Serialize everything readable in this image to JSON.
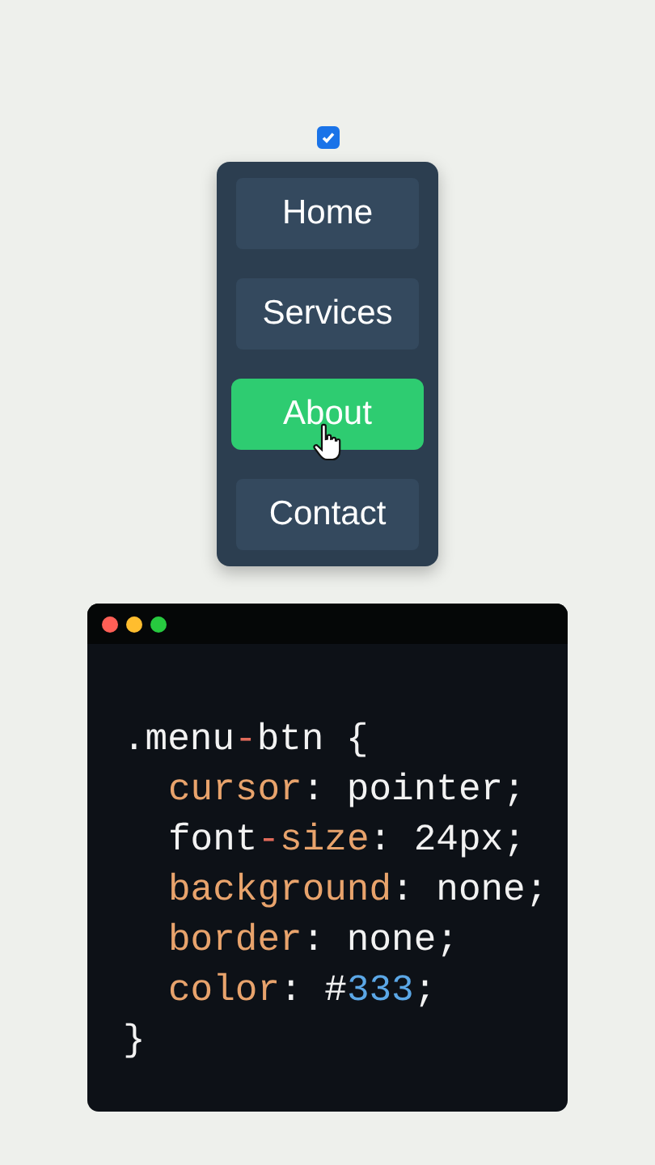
{
  "checkbox": {
    "checked": true
  },
  "menu": [
    {
      "label": "Home",
      "hovered": false
    },
    {
      "label": "Services",
      "hovered": false
    },
    {
      "label": "About",
      "hovered": true
    },
    {
      "label": "Contact",
      "hovered": false
    }
  ],
  "code": {
    "lines": [
      {
        "indent": false,
        "tokens": [
          {
            "kind": "plain",
            "text": ".menu"
          },
          {
            "kind": "operator",
            "text": "-"
          },
          {
            "kind": "plain",
            "text": "btn {"
          }
        ]
      },
      {
        "indent": true,
        "tokens": [
          {
            "kind": "property",
            "text": "cursor"
          },
          {
            "kind": "plain",
            "text": ": pointer;"
          }
        ]
      },
      {
        "indent": true,
        "tokens": [
          {
            "kind": "plain",
            "text": "font"
          },
          {
            "kind": "operator",
            "text": "-"
          },
          {
            "kind": "property",
            "text": "size"
          },
          {
            "kind": "plain",
            "text": ": 24px;"
          }
        ]
      },
      {
        "indent": true,
        "tokens": [
          {
            "kind": "property",
            "text": "background"
          },
          {
            "kind": "plain",
            "text": ": none;"
          }
        ]
      },
      {
        "indent": true,
        "tokens": [
          {
            "kind": "property",
            "text": "border"
          },
          {
            "kind": "plain",
            "text": ": none;"
          }
        ]
      },
      {
        "indent": true,
        "tokens": [
          {
            "kind": "property",
            "text": "color"
          },
          {
            "kind": "plain",
            "text": ": #"
          },
          {
            "kind": "number",
            "text": "333"
          },
          {
            "kind": "plain",
            "text": ";"
          }
        ]
      },
      {
        "indent": false,
        "tokens": [
          {
            "kind": "plain",
            "text": "}"
          }
        ]
      }
    ]
  }
}
